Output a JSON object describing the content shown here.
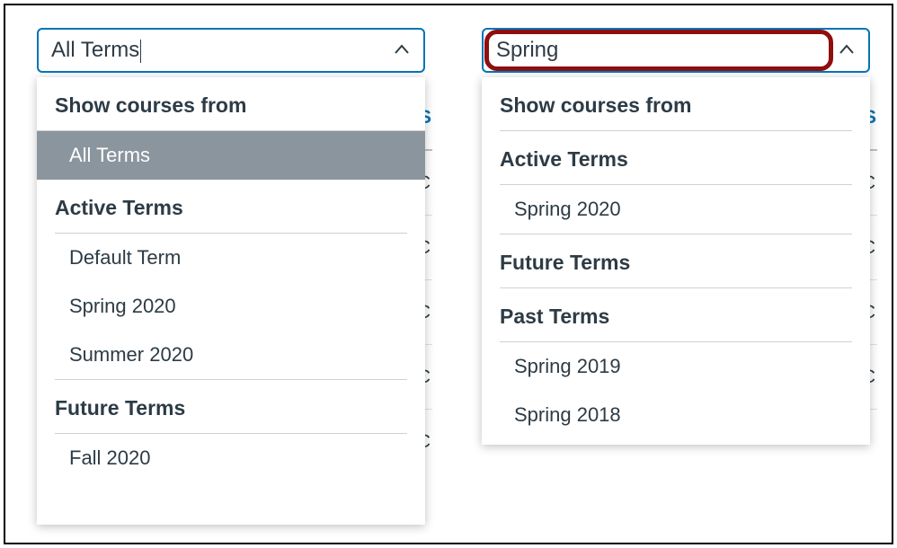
{
  "left": {
    "input_value": "All Terms",
    "show_chevron": "up",
    "dropdown": {
      "header": "Show courses from",
      "selected_option": "All Terms",
      "group_active": {
        "label": "Active Terms",
        "items": [
          "Default Term",
          "Spring 2020",
          "Summer 2020"
        ]
      },
      "group_future": {
        "label": "Future Terms",
        "items": [
          "Fall 2020"
        ]
      }
    },
    "behind": {
      "link_suffix": "S",
      "codes": [
        "OC",
        "OC",
        "OC",
        "OC"
      ],
      "bottom_code": "BOC"
    }
  },
  "right": {
    "input_value": "Spring",
    "show_chevron": "up",
    "dropdown": {
      "header": "Show courses from",
      "group_active": {
        "label": "Active Terms",
        "items": [
          "Spring 2020"
        ]
      },
      "group_future": {
        "label": "Future Terms",
        "items": []
      },
      "group_past": {
        "label": "Past Terms",
        "items": [
          "Spring 2019",
          "Spring 2018"
        ]
      }
    },
    "behind": {
      "link_suffix": "S",
      "codes": [
        "OC",
        "OC",
        "OC",
        "OC"
      ]
    }
  }
}
